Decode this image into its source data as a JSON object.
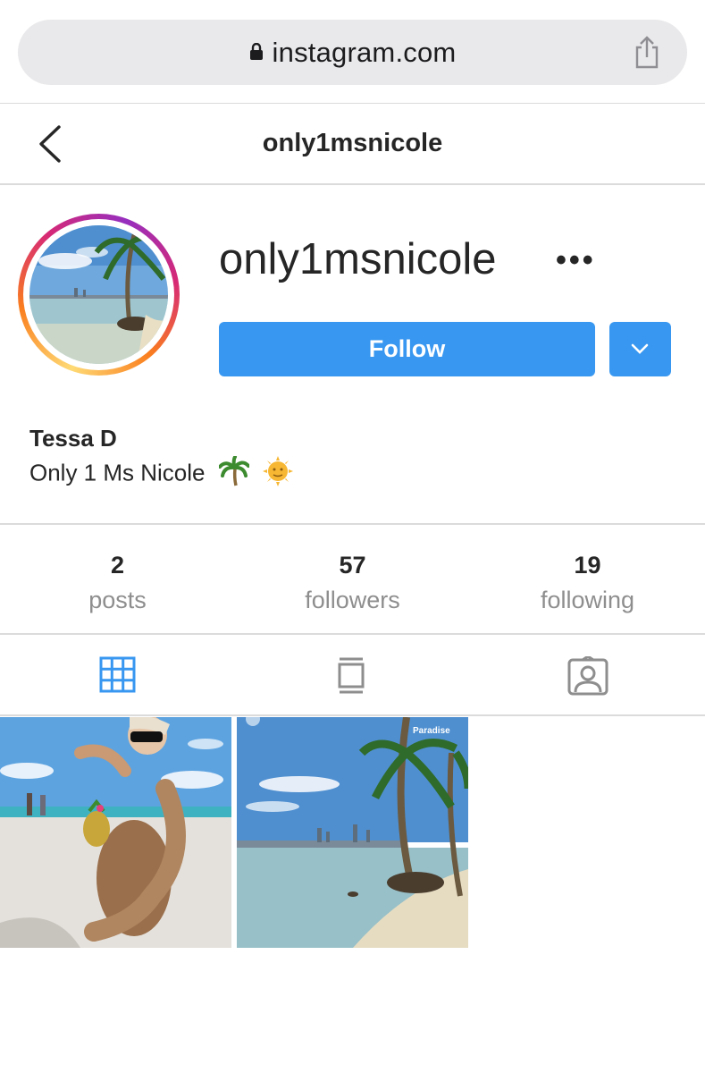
{
  "browser": {
    "url": "instagram.com"
  },
  "header": {
    "title": "only1msnicole"
  },
  "profile": {
    "username": "only1msnicole",
    "follow_label": "Follow",
    "full_name": "Tessa D",
    "bio": "Only 1 Ms Nicole"
  },
  "stats": [
    {
      "value": "2",
      "label": "posts"
    },
    {
      "value": "57",
      "label": "followers"
    },
    {
      "value": "19",
      "label": "following"
    }
  ],
  "tabs": {
    "active": "grid",
    "items": [
      "grid-icon",
      "feed-icon",
      "tagged-icon"
    ]
  },
  "posts": [
    {
      "caption": ""
    },
    {
      "caption": "Paradise"
    }
  ],
  "colors": {
    "accent": "#3897f0",
    "muted_text": "#8e8e8e",
    "border": "#dbdbdb"
  }
}
